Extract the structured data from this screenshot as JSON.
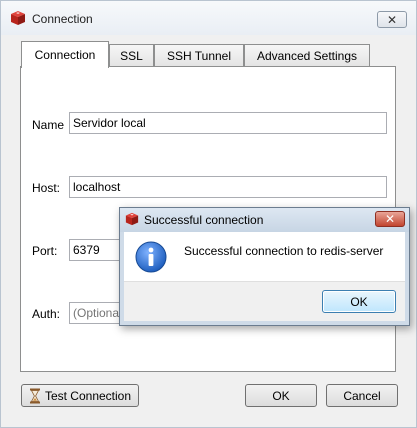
{
  "window": {
    "title": "Connection",
    "close_glyph": "✕",
    "app_icon": "redis-icon"
  },
  "tabs": [
    {
      "label": "Connection",
      "active": true
    },
    {
      "label": "SSL",
      "active": false
    },
    {
      "label": "SSH Tunnel",
      "active": false
    },
    {
      "label": "Advanced Settings",
      "active": false
    }
  ],
  "form": {
    "name_label": "Name",
    "name_value": "Servidor local",
    "host_label": "Host:",
    "host_value": "localhost",
    "port_label": "Port:",
    "port_value": "6379",
    "auth_label": "Auth:",
    "auth_placeholder": "(Optiona"
  },
  "footer": {
    "test_label": "Test Connection",
    "test_icon": "hourglass-icon",
    "ok_label": "OK",
    "cancel_label": "Cancel"
  },
  "dialog": {
    "title": "Successful connection",
    "close_glyph": "✕",
    "message": "Successful connection to redis-server",
    "icon": "info-icon",
    "ok_label": "OK"
  },
  "colors": {
    "accent": "#3c7fb1",
    "dialog_frame": "#cfdbe8",
    "close_red": "#c2452f",
    "info_blue": "#1f5fbf"
  }
}
